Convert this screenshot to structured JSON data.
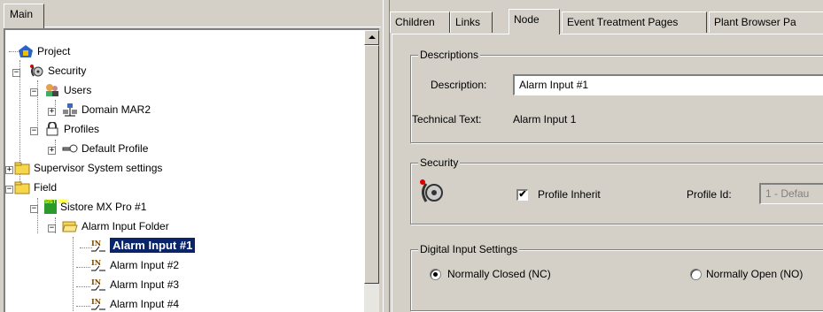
{
  "left_panel": {
    "tab_label": "Main",
    "tree": [
      {
        "label": "Project",
        "icon": "project-icon"
      },
      {
        "label": "Security",
        "icon": "security-icon"
      },
      {
        "label": "Users",
        "icon": "users-icon"
      },
      {
        "label": "Domain MAR2",
        "icon": "domain-icon"
      },
      {
        "label": "Profiles",
        "icon": "profiles-lock-icon"
      },
      {
        "label": "Default Profile",
        "icon": "key-icon"
      },
      {
        "label": "Supervisor System settings",
        "icon": "folder-icon"
      },
      {
        "label": "Field",
        "icon": "folder-icon"
      },
      {
        "label": "Sistore MX Pro #1",
        "icon": "sistore-icon",
        "icon_text": "SIST ORE"
      },
      {
        "label": "Alarm Input Folder",
        "icon": "open-folder-icon"
      },
      {
        "label": "Alarm Input #1",
        "icon": "digital-input-icon",
        "selected": true
      },
      {
        "label": "Alarm Input #2",
        "icon": "digital-input-icon"
      },
      {
        "label": "Alarm Input #3",
        "icon": "digital-input-icon"
      },
      {
        "label": "Alarm Input #4",
        "icon": "digital-input-icon"
      }
    ]
  },
  "right_panel": {
    "tabs": [
      "Children",
      "Links",
      "Node",
      "Event Treatment Pages",
      "Plant Browser Pa"
    ],
    "active_tab": "Node",
    "descriptions": {
      "title": "Descriptions",
      "description_label": "Description:",
      "description_value": "Alarm Input #1",
      "technical_label": "Technical Text:",
      "technical_value": "Alarm Input 1"
    },
    "security": {
      "title": "Security",
      "profile_inherit_label": "Profile Inherit",
      "profile_inherit_checked": true,
      "profile_id_label": "Profile Id:",
      "profile_id_value": "1 - Defau"
    },
    "digital_input": {
      "title": "Digital Input Settings",
      "nc_label": "Normally Closed (NC)",
      "no_label": "Normally Open (NO)",
      "selected": "NC"
    }
  },
  "colors": {
    "selection_bg": "#0a246a",
    "window_bg": "#d4d0c8",
    "folder_yellow": "#f6d64a"
  }
}
